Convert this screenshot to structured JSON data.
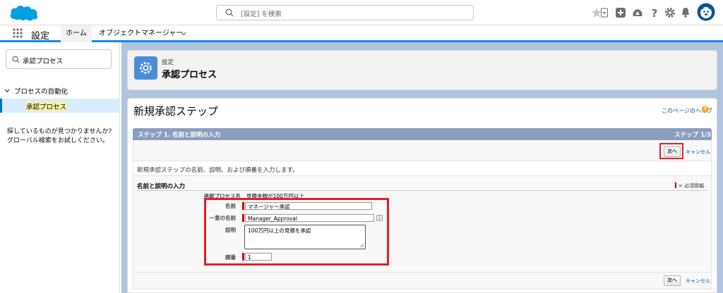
{
  "header": {
    "search_placeholder": "[設定] を検索"
  },
  "app_nav": {
    "app_name": "設定",
    "tabs": [
      {
        "label": "ホーム"
      },
      {
        "label": "オブジェクトマネージャー"
      }
    ]
  },
  "sidebar": {
    "quickfind_value": "承認プロセス",
    "tree_parent": "プロセスの自動化",
    "tree_child": "承認プロセス",
    "no_result_line1": "探しているものが見つかりませんか?",
    "no_result_line2": "グローバル検索をお試しください。"
  },
  "page_header": {
    "breadcrumb": "設定",
    "title": "承認プロセス"
  },
  "content": {
    "title": "新規承認ステップ",
    "help_link": "このページのヘルプ",
    "help_icon": "?",
    "step_title": "ステップ 1. 名前と説明の入力",
    "step_number": "ステップ 1/3",
    "next_label": "次へ",
    "cancel_label": "キャンセル",
    "description": "新規承認ステップの名前、説明、および順番を入力します。",
    "section_title": "名前と説明の入力",
    "required_legend": "= 必須情報",
    "info_icon": "i"
  },
  "form": {
    "process_name_label": "承認プロセス名",
    "process_name_value": "見積金額が100万円以上",
    "name_label": "名前",
    "name_value": "マネージャー承認",
    "unique_name_label": "一意の名前",
    "unique_name_value": "Manager_Approval",
    "description_label": "説明",
    "description_value": "100万円以上の見積を承認",
    "order_label": "順番",
    "order_value": "1"
  },
  "colors": {
    "brand_blue": "#0070d2",
    "step_bar": "#8a9ebe",
    "highlight_red": "#e0202a",
    "required_red": "#cc0000"
  }
}
